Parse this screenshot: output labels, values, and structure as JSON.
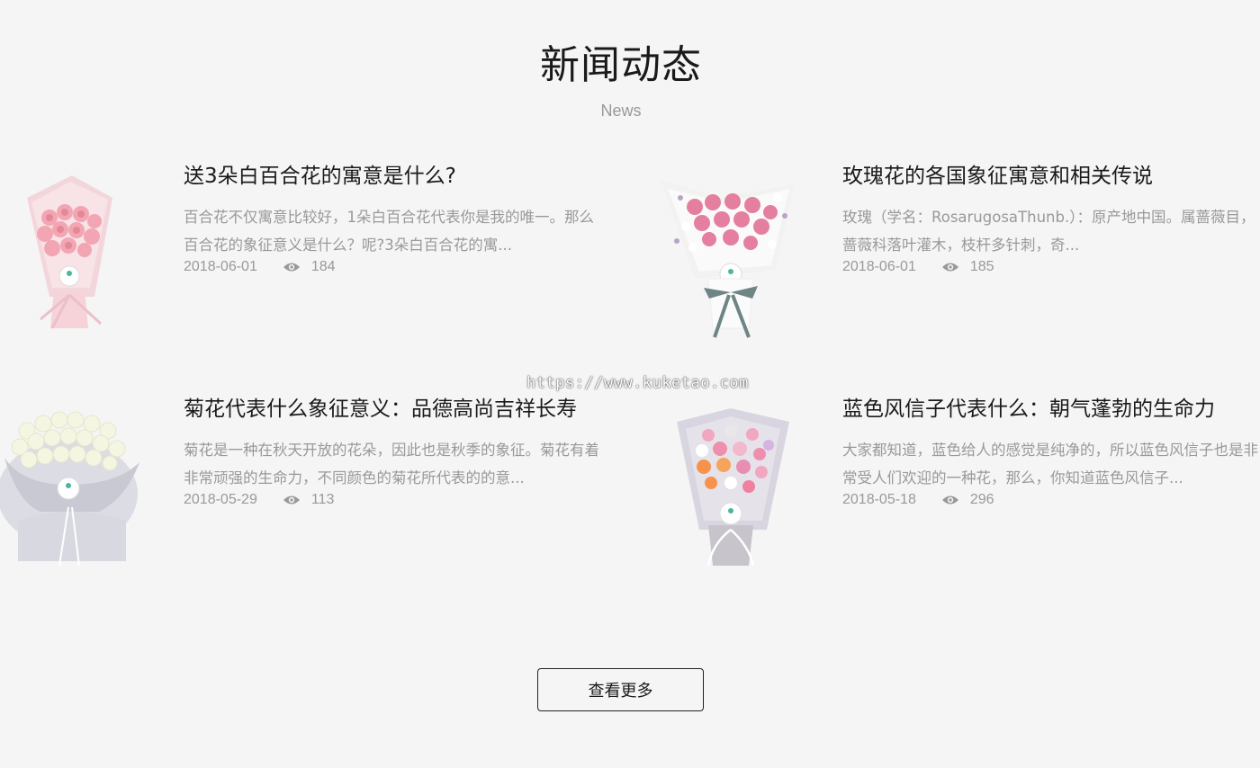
{
  "section": {
    "title": "新闻动态",
    "subtitle": "News"
  },
  "news": [
    {
      "title": "送3朵白百合花的寓意是什么?",
      "description": "百合花不仅寓意比较好，1朵白百合花代表你是我的唯一。那么百合花的象征意义是什么？呢?3朵白百合花的寓...",
      "date": "2018-06-01",
      "views": "184",
      "image": "pink-rose-bouquet"
    },
    {
      "title": "玫瑰花的各国象征寓意和相关传说",
      "description": "玫瑰（学名：RosarugosaThunb.）：原产地中国。属蔷薇目，蔷薇科落叶灌木，枝杆多针刺，奇...",
      "date": "2018-06-01",
      "views": "185",
      "image": "pink-rose-white-wrap-bouquet"
    },
    {
      "title": "菊花代表什么象征意义：品德高尚吉祥长寿",
      "description": "菊花是一种在秋天开放的花朵，因此也是秋季的象征。菊花有着非常顽强的生命力，不同颜色的菊花所代表的的意...",
      "date": "2018-05-29",
      "views": "113",
      "image": "white-rose-bouquet"
    },
    {
      "title": "蓝色风信子代表什么：朝气蓬勃的生命力",
      "description": "大家都知道，蓝色给人的感觉是纯净的，所以蓝色风信子也是非常受人们欢迎的一种花，那么，你知道蓝色风信子...",
      "date": "2018-05-18",
      "views": "296",
      "image": "mixed-flower-bouquet"
    }
  ],
  "more_button": "查看更多",
  "watermark": "https://www.kuketao.com",
  "icons": {
    "views": "eye-icon"
  },
  "colors": {
    "background": "#f5f5f5",
    "title": "#1a1a1a",
    "muted": "#999999"
  }
}
